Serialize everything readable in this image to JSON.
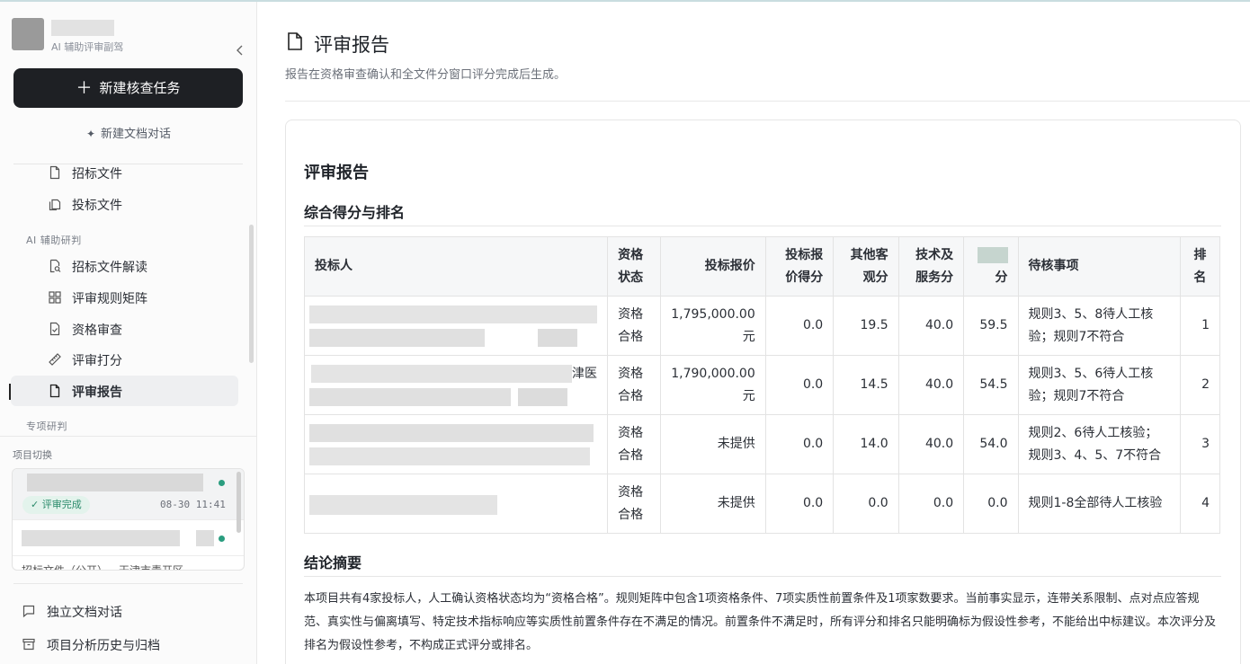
{
  "brand": {
    "subtitle": "AI 辅助评审副驾"
  },
  "sidebar": {
    "new_task_label": "新建核查任务",
    "new_doc_chat_label": "新建文档对话",
    "nav_top": [
      {
        "label": "招标文件",
        "icon": "file-icon"
      },
      {
        "label": "投标文件",
        "icon": "files-icon"
      }
    ],
    "group_ai": "AI 辅助研判",
    "nav_ai": [
      {
        "label": "招标文件解读",
        "icon": "file-search-icon"
      },
      {
        "label": "评审规则矩阵",
        "icon": "grid-icon"
      },
      {
        "label": "资格审查",
        "icon": "file-check-icon"
      },
      {
        "label": "评审打分",
        "icon": "ruler-icon"
      },
      {
        "label": "评审报告",
        "icon": "file-icon",
        "active": true
      }
    ],
    "group_special": "专项研判",
    "project_switch_label": "项目切换",
    "projects": [
      {
        "status": "评审完成",
        "time": "08-30 11:41",
        "status_color": "#2a9d7f"
      },
      {
        "status_color": "#2a9d7f"
      },
      {
        "title_partial": "招标文件（公开）－天津市青开区"
      }
    ],
    "bottom_links": [
      {
        "label": "独立文档对话",
        "icon": "chat-icon"
      },
      {
        "label": "项目分析历史与归档",
        "icon": "archive-icon"
      }
    ]
  },
  "main": {
    "title": "评审报告",
    "subtitle": "报告在资格审查确认和全文件分窗口评分完成后生成。",
    "report_title": "评审报告",
    "section_scores": "综合得分与排名",
    "table": {
      "headers": {
        "bidder": "投标人",
        "status": "资格\n状态",
        "price": "投标报价",
        "price_score": "投标报\n价得分",
        "other_obj": "其他客\n观分",
        "tech": "技术及\n服务分",
        "total_suffix": "分",
        "pending": "待核事项",
        "rank": "排\n名"
      },
      "rows": [
        {
          "status": "资格合格",
          "price": "1,795,000.00元",
          "price_score": "0.0",
          "other_obj": "19.5",
          "tech": "40.0",
          "total": "59.5",
          "pending": "规则3、5、8待人工核验；规则7不符合",
          "rank": "1"
        },
        {
          "bidder_partial": "津医",
          "status": "资格合格",
          "price": "1,790,000.00元",
          "price_score": "0.0",
          "other_obj": "14.5",
          "tech": "40.0",
          "total": "54.5",
          "pending": "规则3、5、6待人工核验；规则7不符合",
          "rank": "2"
        },
        {
          "status": "资格合格",
          "price": "未提供",
          "price_score": "0.0",
          "other_obj": "14.0",
          "tech": "40.0",
          "total": "54.0",
          "pending": "规则2、6待人工核验；规则3、4、5、7不符合",
          "rank": "3"
        },
        {
          "status": "资格合格",
          "price": "未提供",
          "price_score": "0.0",
          "other_obj": "0.0",
          "tech": "0.0",
          "total": "0.0",
          "pending": "规则1-8全部待人工核验",
          "rank": "4"
        }
      ]
    },
    "section_summary": "结论摘要",
    "summary_text": "本项目共有4家投标人，人工确认资格状态均为“资格合格”。规则矩阵中包含1项资格条件、7项实质性前置条件及1项家数要求。当前事实显示，连带关系限制、点对点应答规范、真实性与偏离填写、特定技术指标响应等实质性前置条件存在不满足的情况。前置条件不满足时，所有评分和排名只能明确标为假设性参考，不能给出中标建议。本次评分及排名为假设性参考，不构成正式评分或排名。"
  }
}
